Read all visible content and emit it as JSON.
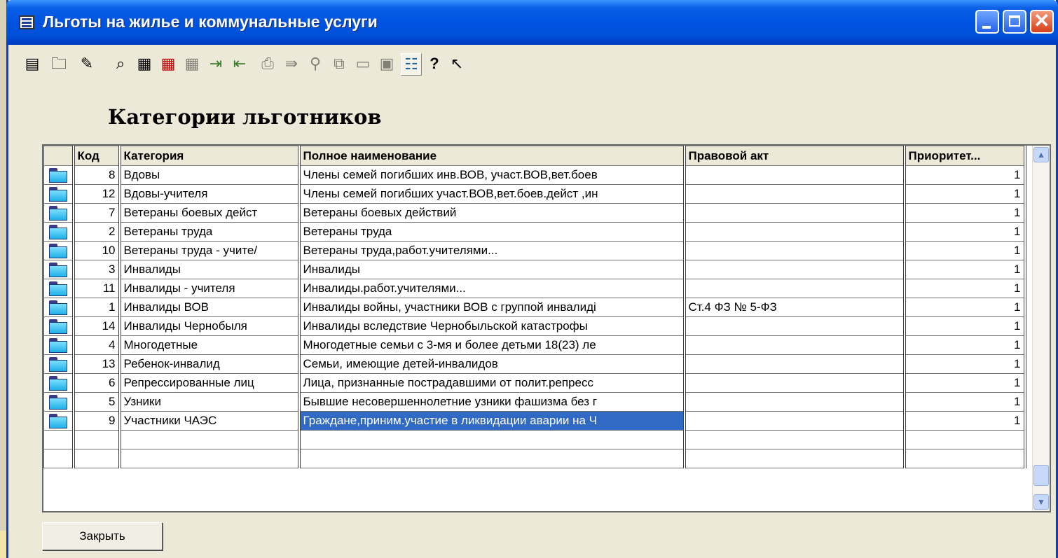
{
  "window": {
    "title": "Льготы на жилье и коммунальные услуги"
  },
  "toolbar": {
    "icons": [
      "new-record-icon",
      "open-folder-icon",
      "edit-icon",
      "find-icon",
      "insert-row-icon",
      "delete-row-icon",
      "copy-row-icon",
      "import-icon",
      "export-icon",
      "print-icon",
      "move-icon",
      "link-icon",
      "copy-icon",
      "paste-icon",
      "paste-special-icon",
      "tree-view-icon",
      "help-icon",
      "context-help-icon"
    ]
  },
  "main": {
    "heading": "Категории льготников",
    "columns": [
      "Код",
      "Категория",
      "Полное наименование",
      "Правовой акт",
      "Приоритет..."
    ],
    "rows": [
      [
        "8",
        "Вдовы",
        "Члены семей погибших инв.ВОВ, участ.ВОВ,вет.боев",
        "",
        "1"
      ],
      [
        "12",
        "Вдовы-учителя",
        "Члены семей погибших участ.ВОВ,вет.боев.дейст ,ин",
        "",
        "1"
      ],
      [
        "7",
        "Ветераны боевых дейст",
        "Ветераны боевых действий",
        "",
        "1"
      ],
      [
        "2",
        "Ветераны труда",
        "Ветераны труда",
        "",
        "1"
      ],
      [
        "10",
        "Ветераны труда - учите/",
        "Ветераны труда,работ.учителями...",
        "",
        "1"
      ],
      [
        "3",
        "Инвалиды",
        "Инвалиды",
        "",
        "1"
      ],
      [
        "11",
        "Инвалиды - учителя",
        "Инвалиды.работ.учителями...",
        "",
        "1"
      ],
      [
        "1",
        "Инвалиды ВОВ",
        "Инвалиды войны, участники ВОВ с группой инвалиді",
        "Ст.4 ФЗ № 5-ФЗ",
        "1"
      ],
      [
        "14",
        "Инвалиды Чернобыля",
        "Инвалиды вследствие Чернобыльской катастрофы",
        "",
        "1"
      ],
      [
        "4",
        "Многодетные",
        "Многодетные семьи с 3-мя и более детьми 18(23) ле",
        "",
        "1"
      ],
      [
        "13",
        "Ребенок-инвалид",
        "Семьи, имеющие детей-инвалидов",
        "",
        "1"
      ],
      [
        "6",
        "Репрессированные лиц",
        "Лица, признанные пострадавшими от полит.репресс",
        "",
        "1"
      ],
      [
        "5",
        "Узники",
        "Бывшие несовершеннолетние узники фашизма без г",
        "",
        "1"
      ],
      [
        "9",
        "Участники ЧАЭС",
        "Граждане,приним.участие в ликвидации аварии на Ч",
        "",
        "1"
      ]
    ],
    "selected_row": 13,
    "selected_col": 2
  },
  "footer": {
    "close_label": "Закрыть"
  }
}
